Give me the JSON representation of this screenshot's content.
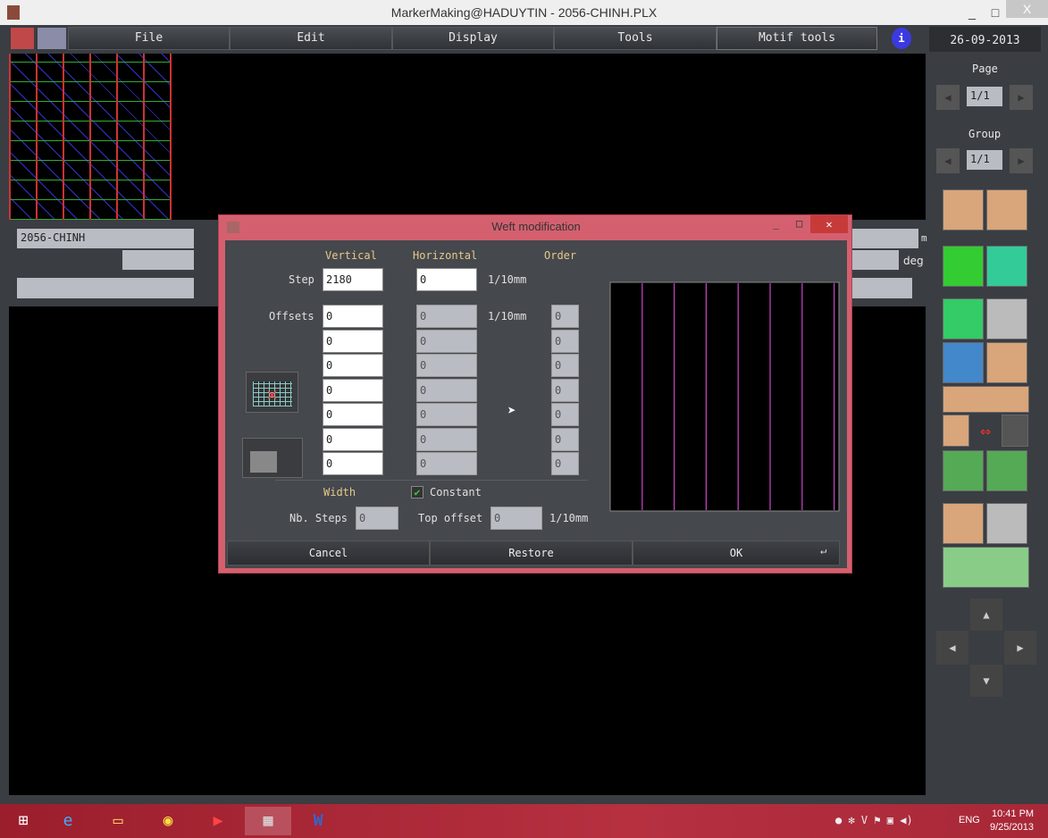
{
  "window": {
    "title": "MarkerMaking@HADUYTIN - 2056-CHINH.PLX",
    "min": "_",
    "max": "□",
    "close": "X"
  },
  "menu": [
    "File",
    "Edit",
    "Display",
    "Tools",
    "Motif tools"
  ],
  "date": "26-09-2013",
  "side": {
    "page_label": "Page",
    "page_value": "1/1",
    "group_label": "Group",
    "group_value": "1/1"
  },
  "info": {
    "marker_name": "2056-CHINH",
    "unit_m": "m",
    "unit_deg": "deg"
  },
  "dialog": {
    "title": "Weft modification",
    "headers": {
      "vertical": "Vertical",
      "horizontal": "Horizontal",
      "order": "Order"
    },
    "step_label": "Step",
    "step_vertical": "2180",
    "step_horizontal": "0",
    "unit": "1/10mm",
    "offsets_label": "Offsets",
    "offsets": [
      {
        "v": "0",
        "h": "0",
        "o": "0"
      },
      {
        "v": "0",
        "h": "0",
        "o": "0"
      },
      {
        "v": "0",
        "h": "0",
        "o": "0"
      },
      {
        "v": "0",
        "h": "0",
        "o": "0"
      },
      {
        "v": "0",
        "h": "0",
        "o": "0"
      },
      {
        "v": "0",
        "h": "0",
        "o": "0"
      },
      {
        "v": "0",
        "h": "0",
        "o": "0"
      }
    ],
    "width_label": "Width",
    "constant_label": "Constant",
    "constant_checked": true,
    "nb_steps_label": "Nb. Steps",
    "nb_steps": "0",
    "top_offset_label": "Top offset",
    "top_offset": "0",
    "buttons": {
      "cancel": "Cancel",
      "restore": "Restore",
      "ok": "OK"
    },
    "preview_line_color": "#c040c0"
  },
  "taskbar": {
    "lang": "ENG",
    "time": "10:41 PM",
    "date": "9/25/2013"
  }
}
